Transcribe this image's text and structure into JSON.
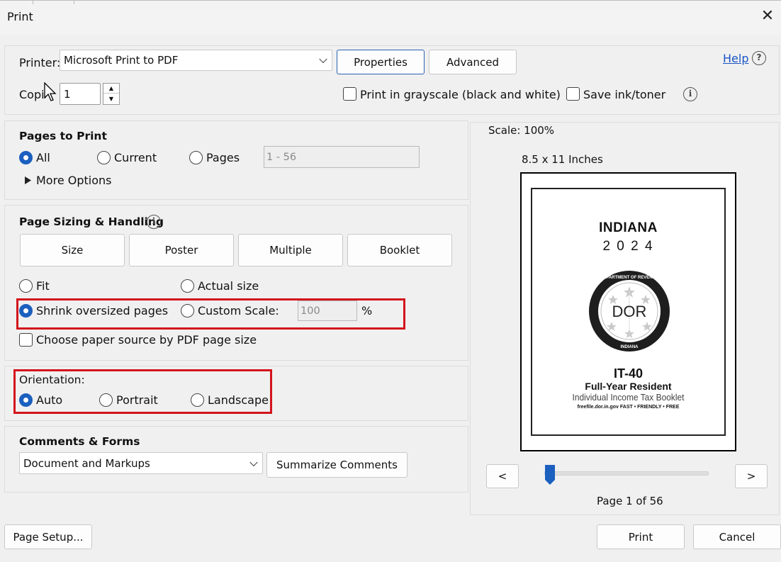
{
  "dialog": {
    "title": "Print",
    "close_glyph": "✕"
  },
  "printer": {
    "label": "Printer:",
    "value": "Microsoft Print to PDF",
    "properties_label": "Properties",
    "advanced_label": "Advanced",
    "help_label": "Help",
    "help_glyph": "?",
    "copies_label": "Copies:",
    "copies_value": "1",
    "grayscale_label": "Print in grayscale (black and white)",
    "save_ink_label": "Save ink/toner",
    "info_glyph": "i"
  },
  "pages_to_print": {
    "heading": "Pages to Print",
    "all_label": "All",
    "current_label": "Current",
    "pages_label": "Pages",
    "pages_value": "1 - 56",
    "more_options_label": "More Options",
    "selected": "All"
  },
  "page_sizing": {
    "heading": "Page Sizing & Handling",
    "tabs": [
      "Size",
      "Poster",
      "Multiple",
      "Booklet"
    ],
    "fit_label": "Fit",
    "actual_size_label": "Actual size",
    "shrink_label": "Shrink oversized pages",
    "custom_scale_label": "Custom Scale:",
    "custom_scale_value": "100",
    "percent_sign": "%",
    "paper_source_label": "Choose paper source by PDF page size",
    "selected": "Shrink oversized pages"
  },
  "orientation": {
    "heading": "Orientation:",
    "auto_label": "Auto",
    "portrait_label": "Portrait",
    "landscape_label": "Landscape",
    "selected": "Auto"
  },
  "comments_forms": {
    "heading": "Comments & Forms",
    "value": "Document and Markups",
    "summarize_label": "Summarize Comments"
  },
  "preview": {
    "scale_label": "Scale: 100%",
    "paper_size_label": "8.5 x 11 Inches",
    "page_label": "Page 1 of 56",
    "prev_label": "<",
    "next_label": ">",
    "slider_position": 0.0,
    "document": {
      "state": "INDIANA",
      "year": "2 0 2 4",
      "seal_top_text": "DEPARTMENT OF REVENUE",
      "seal_center": "DOR",
      "seal_bottom_text": "INDIANA",
      "form_number": "IT-40",
      "form_subtitle": "Full-Year Resident",
      "form_description": "Individual Income Tax Booklet",
      "tagline": "freefile.dor.in.gov  FAST • FRIENDLY • FREE"
    }
  },
  "footer": {
    "page_setup_label": "Page Setup...",
    "print_label": "Print",
    "cancel_label": "Cancel"
  },
  "colors": {
    "highlight_red": "#d3141c",
    "accent_blue": "#1b5fbf",
    "link_blue": "#1a55c4"
  }
}
